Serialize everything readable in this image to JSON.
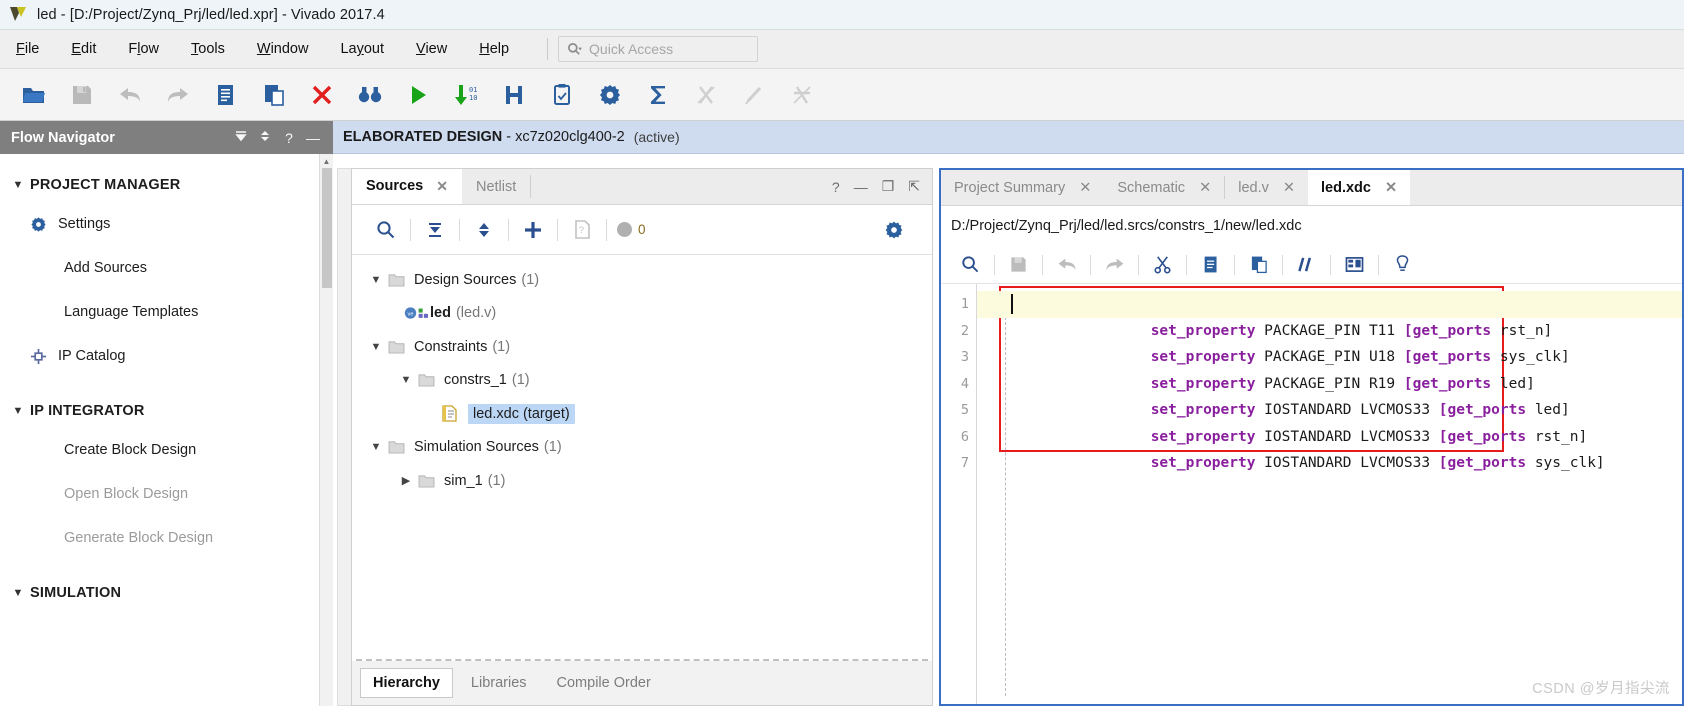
{
  "window": {
    "title": "led - [D:/Project/Zynq_Prj/led/led.xpr] - Vivado 2017.4",
    "logo_icon": "vivado-logo-icon"
  },
  "menu": {
    "items": [
      {
        "label": "File",
        "mnemonic": "F"
      },
      {
        "label": "Edit",
        "mnemonic": "E"
      },
      {
        "label": "Flow",
        "mnemonic": "l"
      },
      {
        "label": "Tools",
        "mnemonic": "T"
      },
      {
        "label": "Window",
        "mnemonic": "W"
      },
      {
        "label": "Layout",
        "mnemonic": "y"
      },
      {
        "label": "View",
        "mnemonic": "V"
      },
      {
        "label": "Help",
        "mnemonic": "H"
      }
    ],
    "quick_access": {
      "placeholder": "Quick Access",
      "icon": "search-dropdown-icon"
    }
  },
  "toolbar": {
    "buttons": [
      {
        "name": "open-project-icon",
        "title": "Open Project",
        "enabled": true
      },
      {
        "name": "save-icon",
        "title": "Save",
        "enabled": false
      },
      {
        "name": "undo-icon",
        "title": "Undo",
        "enabled": false
      },
      {
        "name": "redo-icon",
        "title": "Redo",
        "enabled": false
      },
      {
        "name": "copy-icon",
        "title": "Copy",
        "enabled": true
      },
      {
        "name": "paste-icon",
        "title": "Paste",
        "enabled": true
      },
      {
        "name": "close-icon",
        "title": "Close",
        "enabled": true
      },
      {
        "name": "binoculars-icon",
        "title": "Find",
        "enabled": true
      },
      {
        "name": "run-icon",
        "title": "Run",
        "enabled": true
      },
      {
        "name": "program-device-icon",
        "title": "Program Device",
        "enabled": true
      },
      {
        "name": "implement-icon",
        "title": "Implementation",
        "enabled": true
      },
      {
        "name": "report-icon",
        "title": "Report",
        "enabled": true
      },
      {
        "name": "settings-gear-icon",
        "title": "Settings",
        "enabled": true
      },
      {
        "name": "sigma-icon",
        "title": "Summary",
        "enabled": true
      },
      {
        "name": "disabled-tool-a-icon",
        "title": "Tool",
        "enabled": false
      },
      {
        "name": "disabled-tool-b-icon",
        "title": "Tool",
        "enabled": false
      },
      {
        "name": "disabled-tool-c-icon",
        "title": "Tool",
        "enabled": false
      }
    ]
  },
  "flow_navigator": {
    "header": {
      "title": "Flow Navigator",
      "collapse_all_icon": "collapse-all-icon",
      "expand_icon": "expand-collapse-icon",
      "help_icon": "help-question-icon",
      "minimize_icon": "minimize-icon"
    },
    "sections": [
      {
        "label": "PROJECT MANAGER",
        "expanded": true,
        "items": [
          {
            "label": "Settings",
            "icon": "gear-icon",
            "enabled": true
          },
          {
            "label": "Add Sources",
            "icon": null,
            "enabled": true
          },
          {
            "label": "Language Templates",
            "icon": null,
            "enabled": true
          },
          {
            "label": "IP Catalog",
            "icon": "ip-catalog-icon",
            "enabled": true
          }
        ]
      },
      {
        "label": "IP INTEGRATOR",
        "expanded": true,
        "items": [
          {
            "label": "Create Block Design",
            "icon": null,
            "enabled": true
          },
          {
            "label": "Open Block Design",
            "icon": null,
            "enabled": false
          },
          {
            "label": "Generate Block Design",
            "icon": null,
            "enabled": false
          }
        ]
      },
      {
        "label": "SIMULATION",
        "expanded": true,
        "items": []
      }
    ]
  },
  "design_bar": {
    "state": "ELABORATED DESIGN",
    "dash": "-",
    "device": "xc7z020clg400-2",
    "status": "(active)"
  },
  "sources_panel": {
    "tabs": [
      {
        "label": "Sources",
        "active": true,
        "closable": true
      },
      {
        "label": "Netlist",
        "active": false,
        "closable": false
      }
    ],
    "header_controls": {
      "help_icon": "help-question-icon",
      "minimize_icon": "minimize-icon",
      "maximize_icon": "maximize-icon",
      "float_icon": "float-window-icon"
    },
    "toolbar": [
      {
        "name": "search-icon",
        "title": "Search",
        "enabled": true
      },
      {
        "name": "collapse-all-icon",
        "title": "Collapse All",
        "enabled": true
      },
      {
        "name": "expand-all-icon",
        "title": "Expand All",
        "enabled": true
      },
      {
        "name": "add-sources-icon",
        "title": "Add Sources",
        "enabled": true
      },
      {
        "name": "report-file-icon",
        "title": "Report",
        "enabled": false
      }
    ],
    "badge": {
      "icon": "status-dot-icon",
      "count": "0"
    },
    "gear_icon": "settings-gear-icon",
    "tree": [
      {
        "depth": 0,
        "label": "Design Sources",
        "count": "(1)",
        "expanded": true,
        "icon": "folder-icon",
        "selected": false
      },
      {
        "depth": 1,
        "label": "led",
        "suffix": "(led.v)",
        "icon": "verilog-module-icon",
        "selected": false,
        "bold": true
      },
      {
        "depth": 0,
        "label": "Constraints",
        "count": "(1)",
        "expanded": true,
        "icon": "folder-icon",
        "selected": false
      },
      {
        "depth": 1,
        "label": "constrs_1",
        "count": "(1)",
        "expanded": true,
        "icon": "folder-icon",
        "selected": false
      },
      {
        "depth": 2,
        "label": "led.xdc (target)",
        "icon": "xdc-file-icon",
        "selected": true
      },
      {
        "depth": 0,
        "label": "Simulation Sources",
        "count": "(1)",
        "expanded": true,
        "icon": "folder-icon",
        "selected": false
      },
      {
        "depth": 1,
        "label": "sim_1",
        "count": "(1)",
        "expanded": false,
        "icon": "folder-icon",
        "selected": false
      }
    ],
    "bottom_tabs": [
      {
        "label": "Hierarchy",
        "active": true
      },
      {
        "label": "Libraries",
        "active": false
      },
      {
        "label": "Compile Order",
        "active": false
      }
    ]
  },
  "editor": {
    "tabs": [
      {
        "label": "Project Summary",
        "active": false,
        "closable": true
      },
      {
        "label": "Schematic",
        "active": false,
        "closable": true
      },
      {
        "label": "led.v",
        "active": false,
        "closable": true
      },
      {
        "label": "led.xdc",
        "active": true,
        "closable": true
      }
    ],
    "file_path": "D:/Project/Zynq_Prj/led/led.srcs/constrs_1/new/led.xdc",
    "toolbar": [
      {
        "name": "search-icon",
        "title": "Find",
        "enabled": true
      },
      {
        "name": "save-icon",
        "title": "Save File",
        "enabled": false
      },
      {
        "name": "undo-icon",
        "title": "Undo",
        "enabled": false
      },
      {
        "name": "redo-icon",
        "title": "Redo",
        "enabled": false
      },
      {
        "name": "cut-scissors-icon",
        "title": "Cut",
        "enabled": true
      },
      {
        "name": "copy-icon",
        "title": "Copy",
        "enabled": true
      },
      {
        "name": "paste-icon",
        "title": "Paste",
        "enabled": true
      },
      {
        "name": "comment-icon",
        "title": "Toggle Comment",
        "enabled": true
      },
      {
        "name": "columns-icon",
        "title": "Column Edit",
        "enabled": true
      },
      {
        "name": "bulb-icon",
        "title": "Hints",
        "enabled": true
      }
    ],
    "code_lines": [
      {
        "num": "1",
        "highlighted": true,
        "tokens": [
          {
            "t": "set_property",
            "c": "kw"
          },
          {
            "t": " PACKAGE_PIN T11 ",
            "c": "pin"
          },
          {
            "t": "[get_ports",
            "c": "kw2"
          },
          {
            "t": " rst_n]",
            "c": "pin"
          }
        ]
      },
      {
        "num": "2",
        "highlighted": false,
        "tokens": [
          {
            "t": "set_property",
            "c": "kw"
          },
          {
            "t": " PACKAGE_PIN U18 ",
            "c": "pin"
          },
          {
            "t": "[get_ports",
            "c": "kw2"
          },
          {
            "t": " sys_clk]",
            "c": "pin"
          }
        ]
      },
      {
        "num": "3",
        "highlighted": false,
        "tokens": [
          {
            "t": "set_property",
            "c": "kw"
          },
          {
            "t": " PACKAGE_PIN R19 ",
            "c": "pin"
          },
          {
            "t": "[get_ports",
            "c": "kw2"
          },
          {
            "t": " led]",
            "c": "pin"
          }
        ]
      },
      {
        "num": "4",
        "highlighted": false,
        "tokens": [
          {
            "t": "set_property",
            "c": "kw"
          },
          {
            "t": " IOSTANDARD LVCMOS33 ",
            "c": "pin"
          },
          {
            "t": "[get_ports",
            "c": "kw2"
          },
          {
            "t": " led]",
            "c": "pin"
          }
        ]
      },
      {
        "num": "5",
        "highlighted": false,
        "tokens": [
          {
            "t": "set_property",
            "c": "kw"
          },
          {
            "t": " IOSTANDARD LVCMOS33 ",
            "c": "pin"
          },
          {
            "t": "[get_ports",
            "c": "kw2"
          },
          {
            "t": " rst_n]",
            "c": "pin"
          }
        ]
      },
      {
        "num": "6",
        "highlighted": false,
        "tokens": [
          {
            "t": "set_property",
            "c": "kw"
          },
          {
            "t": " IOSTANDARD LVCMOS33 ",
            "c": "pin"
          },
          {
            "t": "[get_ports",
            "c": "kw2"
          },
          {
            "t": " sys_clk]",
            "c": "pin"
          }
        ]
      },
      {
        "num": "7",
        "highlighted": false,
        "tokens": []
      }
    ]
  },
  "watermark": "CSDN @岁月指尖流",
  "colors": {
    "accent_blue": "#3a6fc4",
    "keyword_purple": "#8a1f9e",
    "highlight_yellow": "#fdfbdd",
    "selection_blue": "#bcd7f5",
    "design_bar_blue": "#cfdcf0",
    "red_box": "#e81b1b",
    "flow_nav_gray": "#807f7f"
  }
}
